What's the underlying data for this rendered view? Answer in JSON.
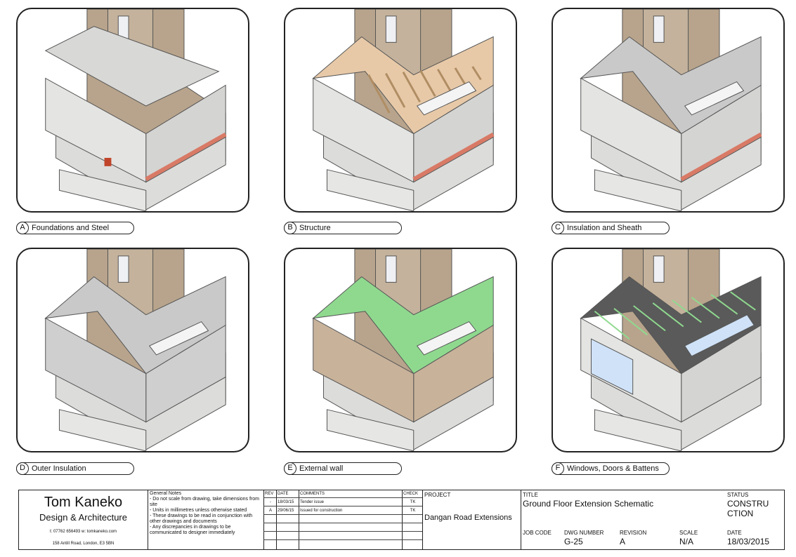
{
  "panels": [
    {
      "letter": "A",
      "label": "Foundations and Steel",
      "stage": "foundations"
    },
    {
      "letter": "B",
      "label": "Structure",
      "stage": "structure"
    },
    {
      "letter": "C",
      "label": "Insulation and Sheath",
      "stage": "insulation"
    },
    {
      "letter": "D",
      "label": "Outer Insulation",
      "stage": "outer"
    },
    {
      "letter": "E",
      "label": "External wall",
      "stage": "external"
    },
    {
      "letter": "F",
      "label": "Windows, Doors & Battens",
      "stage": "windows"
    }
  ],
  "colors": {
    "brick": "#b8a48c",
    "block": "#d4d4d2",
    "plinth": "#dcdcda",
    "dpc": "#d87a66",
    "timber": "#e7c9a8",
    "roof_grey": "#c9c9c9",
    "green": "#8fd98f",
    "render": "#c8b29a",
    "glass": "#cfe2f8",
    "dark": "#444444"
  },
  "titleblock": {
    "firm_name": "Tom Kaneko",
    "firm_sub": "Design & Architecture",
    "contact": "t: 07762 656493   w: tomkaneko.com",
    "address": "158 Antill Road, London, E3 5BN",
    "notes_title": "General Notes",
    "notes": [
      "- Do not scale from drawing, take dimensions from site",
      "- Units in millimetres unless otherwise stated",
      "- These drawings to be read in conjunction with other drawings and documents",
      "- Any discrepancies in drawings to be communicated to designer immediately"
    ],
    "rev_headers": {
      "rev": "REV",
      "date": "DATE",
      "comments": "COMMENTS",
      "check": "CHECK"
    },
    "revisions": [
      {
        "rev": "-",
        "date": "18/03/15",
        "comments": "Tender issue",
        "check": "TK"
      },
      {
        "rev": "A",
        "date": "29/06/15",
        "comments": "Issued for construction",
        "check": "TK"
      }
    ],
    "project_label": "PROJECT",
    "project": "Dangan Road Extensions",
    "title_label": "TITLE",
    "title": "Ground Floor Extension Schematic",
    "status_label": "STATUS",
    "status_line1": "CONSTRU",
    "status_line2": "CTION",
    "job_code_label": "JOB CODE",
    "dwg_label": "DWG NUMBER",
    "dwg": "G-25",
    "revision_label": "REVISION",
    "revision": "A",
    "scale_label": "SCALE",
    "scale": "N/A",
    "date_label": "DATE",
    "date": "18/03/2015"
  }
}
